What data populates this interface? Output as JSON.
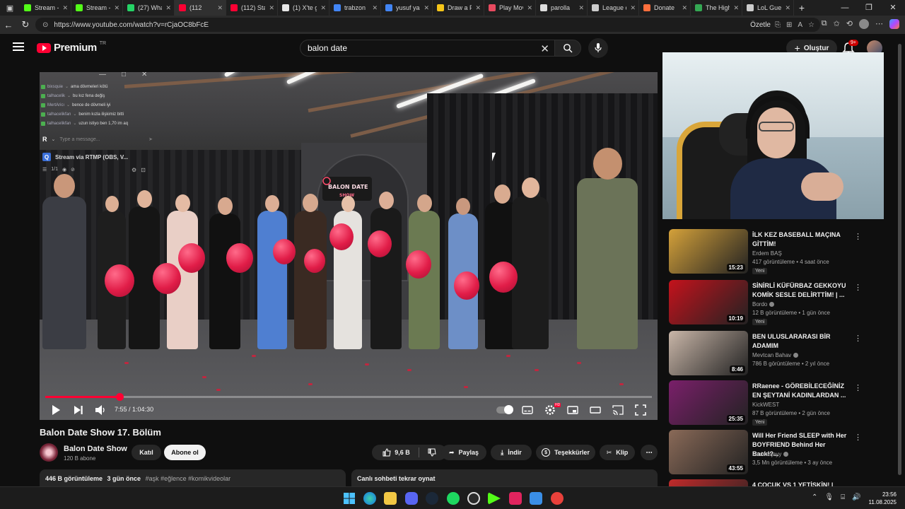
{
  "browser": {
    "tabs": [
      {
        "label": "Stream -",
        "fav": "kick-icon",
        "color": "#53fc18",
        "active": false
      },
      {
        "label": "Stream -",
        "fav": "kick-icon",
        "color": "#53fc18",
        "active": false
      },
      {
        "label": "(27) What",
        "fav": "whatsapp-icon",
        "color": "#25d366",
        "active": false
      },
      {
        "label": "(112",
        "fav": "youtube-icon",
        "color": "#ff0033",
        "active": true
      },
      {
        "label": "(112) Stat",
        "fav": "youtube-icon",
        "color": "#ff0033",
        "active": false
      },
      {
        "label": "(1) X'te g",
        "fav": "x-icon",
        "color": "#e7e7e7",
        "active": false
      },
      {
        "label": "trabzon",
        "fav": "google-icon",
        "color": "#4285f4",
        "active": false
      },
      {
        "label": "yusuf yas",
        "fav": "google-icon",
        "color": "#4285f4",
        "active": false
      },
      {
        "label": "Draw a P",
        "fav": "draw-icon",
        "color": "#f5c518",
        "active": false
      },
      {
        "label": "Play Mov",
        "fav": "play-icon",
        "color": "#e84a5f",
        "active": false
      },
      {
        "label": "parolla",
        "fav": "parolla-icon",
        "color": "#dddddd",
        "active": false
      },
      {
        "label": "League c",
        "fav": "doc-icon",
        "color": "#cccccc",
        "active": false
      },
      {
        "label": "Donate",
        "fav": "donate-icon",
        "color": "#ff6f3d",
        "active": false
      },
      {
        "label": "The High",
        "fav": "arrow-icon",
        "color": "#34a853",
        "active": false
      },
      {
        "label": "LoL Gues",
        "fav": "globe-icon",
        "color": "#cccccc",
        "active": false
      }
    ],
    "url": "https://www.youtube.com/watch?v=rCjaOC8bFcE",
    "summary_label": "Özetle"
  },
  "header": {
    "brand": "Premium",
    "region": "TR",
    "search_value": "balon date",
    "create_label": "Oluştur",
    "notif_count": "9+"
  },
  "player": {
    "chat": [
      {
        "user": "bixsquie",
        "text": "ama dövmeleri kötü"
      },
      {
        "user": "talhacelik",
        "text": "bu kız fena değiş"
      },
      {
        "user": "MertAricı",
        "text": "bence de dövmeli iyi"
      },
      {
        "user": "talhacelikfan",
        "text": "benim kızla ilişkimiz bitti"
      },
      {
        "user": "talhacelikfan",
        "text": "uzun istiyo ben 1,70 im aq"
      }
    ],
    "chat_placeholder": "Type a message...",
    "chat_initial": "R",
    "stream_source": "Stream via RTMP (OBS, V...",
    "stream_count": "1/1",
    "sign_text": "BALON DATE SHOW",
    "time_current": "7:55",
    "time_sep": " / ",
    "time_total": "1:04:30",
    "progress": 0.1229,
    "hd_label": "HD"
  },
  "video": {
    "title": "Balon Date Show 17. Bölüm",
    "channel": "Balon Date Show",
    "subscribers": "120 B abone",
    "join_label": "Katıl",
    "subscribe_label": "Abone ol",
    "likes": "9,6 B",
    "share_label": "Paylaş",
    "download_label": "İndir",
    "thanks_label": "Teşekkürler",
    "clip_label": "Klip",
    "views": "446 B görüntüleme",
    "date": "3 gün önce",
    "tags": "#aşk #eğlence #komikvideolar",
    "chat_replay_label": "Canlı sohbeti tekrar oynat"
  },
  "recs": [
    {
      "title": "İLK KEZ BASEBALL MAÇINA GİTTİM!",
      "channel": "Erdem BAŞ",
      "verified": false,
      "meta": "417 görüntüleme • 4 saat önce",
      "badge": "Yeni",
      "duration": "15:23",
      "thumb": "#d4a13a"
    },
    {
      "title": "SİNİRLİ KÜFÜRBAZ GEKKOYU KOMİK SESLE DELİRTTİM! | ...",
      "channel": "Bordo",
      "verified": true,
      "meta": "12 B görüntüleme • 1 gün önce",
      "badge": "Yeni",
      "duration": "10:19",
      "thumb": "#c4121c"
    },
    {
      "title": "BEN ULUSLARARASI BİR ADAMIM",
      "channel": "Mevtcan Bahav",
      "verified": true,
      "meta": "786 B görüntüleme • 2 yıl önce",
      "badge": "",
      "duration": "8:46",
      "thumb": "#c9b6a8"
    },
    {
      "title": "RRaenee - GÖREBİLECEĞİNİZ EN ŞEYTANİ KADINLARDAN ...",
      "channel": "KickWEST",
      "verified": false,
      "meta": "87 B görüntüleme • 2 gün önce",
      "badge": "Yeni",
      "duration": "25:35",
      "thumb": "#7a1f6a"
    },
    {
      "title": "Will Her Friend SLEEP with Her BOYFRIEND Behind Her Back!?...",
      "channel": "soulessjayy",
      "verified": true,
      "meta": "3,5 Mn görüntüleme • 3 ay önce",
      "badge": "",
      "duration": "43:55",
      "thumb": "#8a6a58"
    },
    {
      "title": "4 ÇOCUK VS 1 YETİŞKİN! |",
      "channel": "",
      "verified": false,
      "meta": "",
      "badge": "",
      "duration": "",
      "thumb": "#c02a2a"
    }
  ],
  "taskbar": {
    "time": "23:56",
    "date": "11.08.2025"
  }
}
